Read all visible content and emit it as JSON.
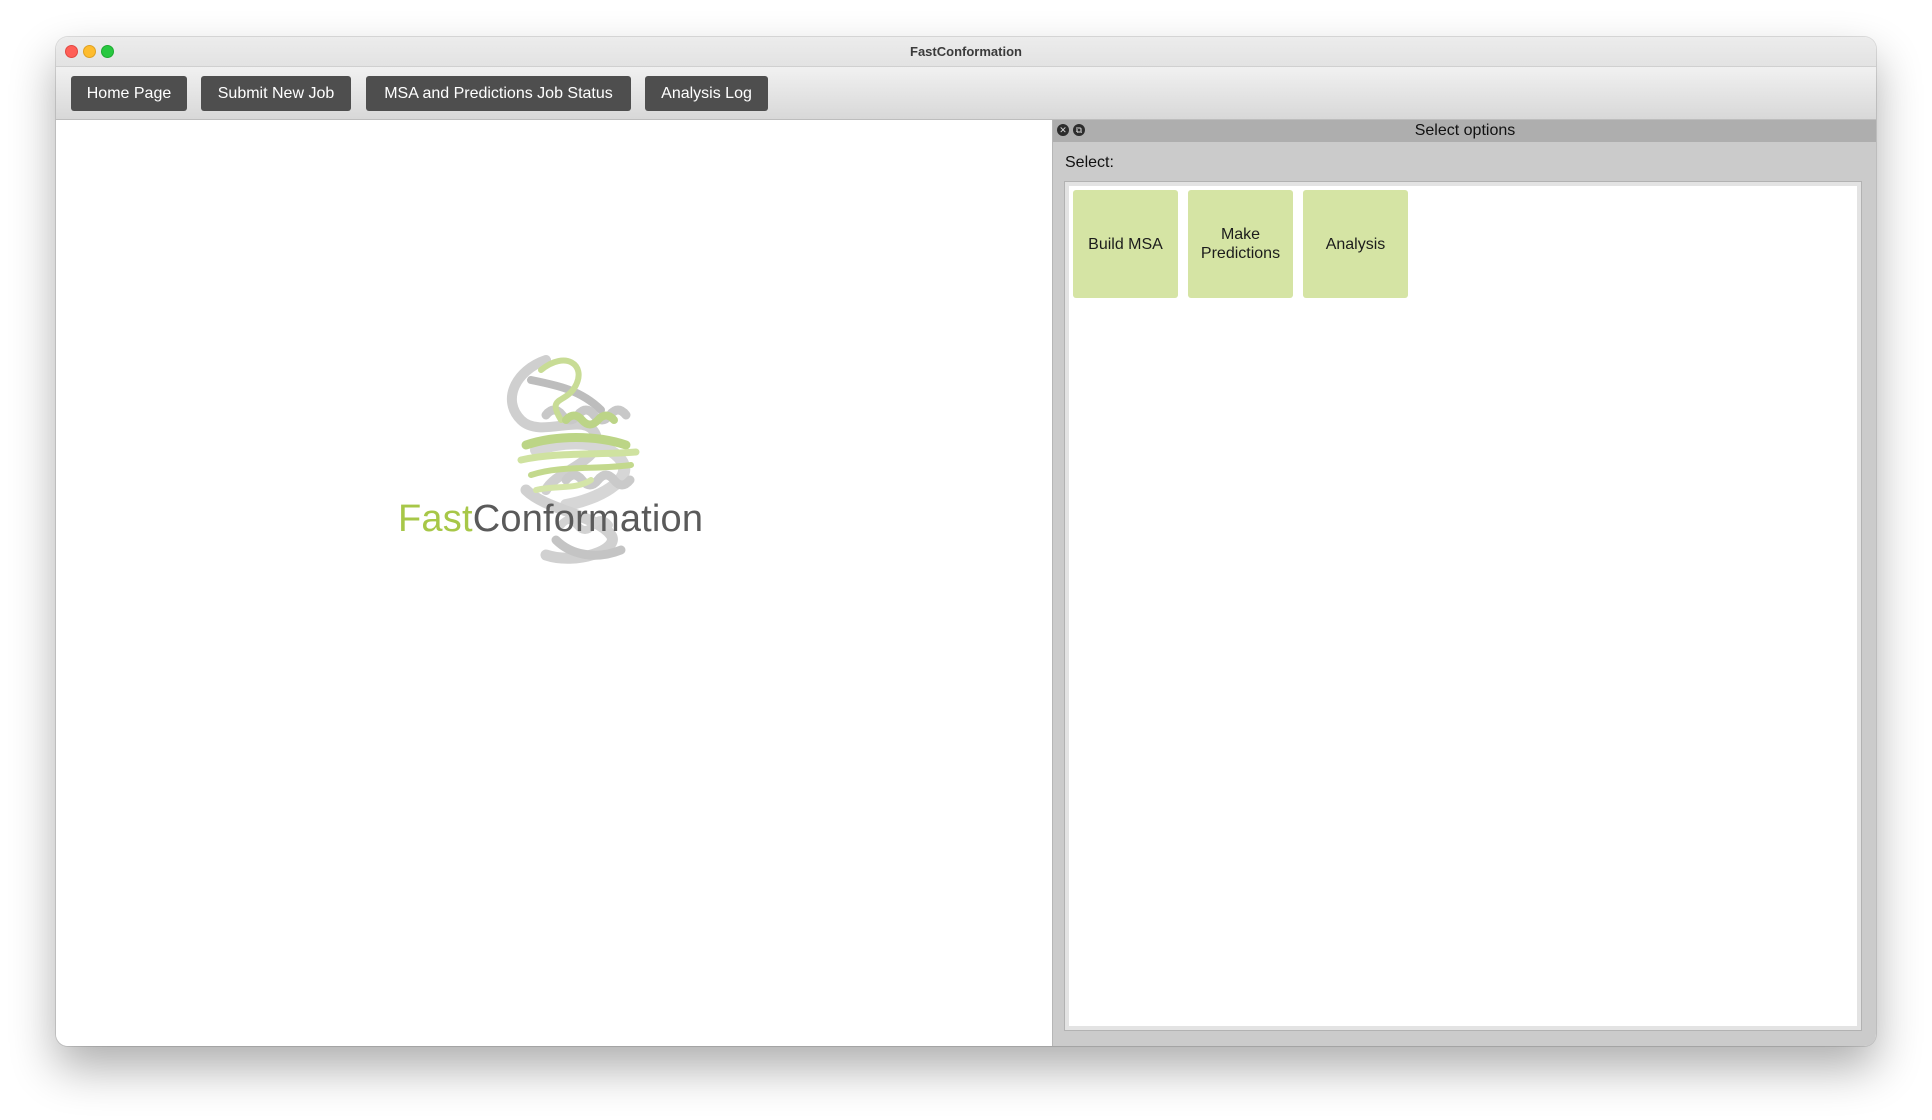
{
  "window": {
    "title": "FastConformation"
  },
  "toolbar": {
    "buttons": [
      {
        "label": "Home Page"
      },
      {
        "label": "Submit New Job"
      },
      {
        "label": "MSA and Predictions Job Status"
      },
      {
        "label": "Analysis Log"
      }
    ]
  },
  "logo": {
    "text_part1": "Fast",
    "text_part2": "Conformation",
    "colors": {
      "accent": "#a7c748",
      "text": "#5a5a5a"
    }
  },
  "dock": {
    "title": "Select options",
    "select_label": "Select:",
    "options": [
      {
        "label": "Build MSA"
      },
      {
        "label": "Make\nPredictions"
      },
      {
        "label": "Analysis"
      }
    ],
    "option_color": "#d5e4a4"
  }
}
